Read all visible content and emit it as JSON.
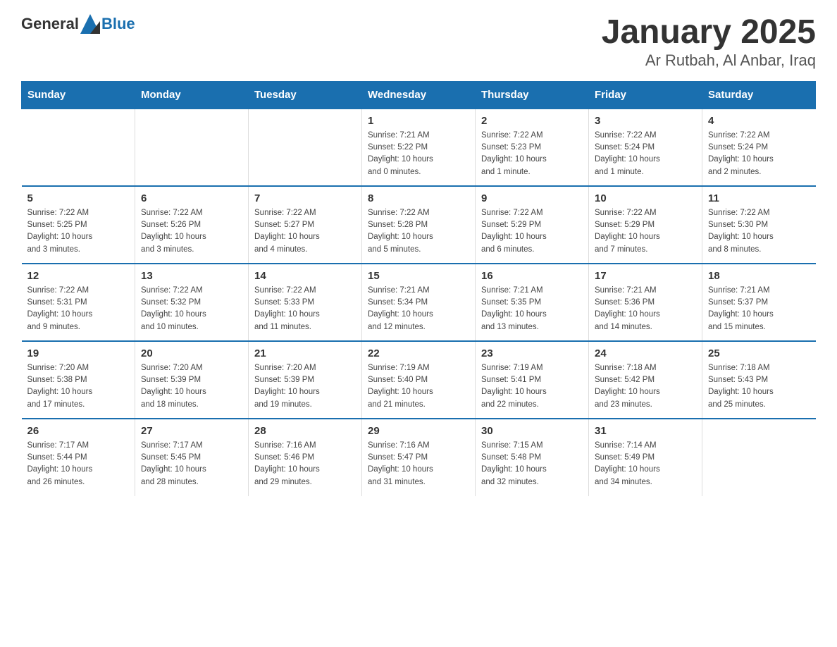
{
  "header": {
    "logo_general": "General",
    "logo_blue": "Blue",
    "title": "January 2025",
    "subtitle": "Ar Rutbah, Al Anbar, Iraq"
  },
  "calendar": {
    "days_of_week": [
      "Sunday",
      "Monday",
      "Tuesday",
      "Wednesday",
      "Thursday",
      "Friday",
      "Saturday"
    ],
    "weeks": [
      [
        {
          "day": "",
          "info": ""
        },
        {
          "day": "",
          "info": ""
        },
        {
          "day": "",
          "info": ""
        },
        {
          "day": "1",
          "info": "Sunrise: 7:21 AM\nSunset: 5:22 PM\nDaylight: 10 hours\nand 0 minutes."
        },
        {
          "day": "2",
          "info": "Sunrise: 7:22 AM\nSunset: 5:23 PM\nDaylight: 10 hours\nand 1 minute."
        },
        {
          "day": "3",
          "info": "Sunrise: 7:22 AM\nSunset: 5:24 PM\nDaylight: 10 hours\nand 1 minute."
        },
        {
          "day": "4",
          "info": "Sunrise: 7:22 AM\nSunset: 5:24 PM\nDaylight: 10 hours\nand 2 minutes."
        }
      ],
      [
        {
          "day": "5",
          "info": "Sunrise: 7:22 AM\nSunset: 5:25 PM\nDaylight: 10 hours\nand 3 minutes."
        },
        {
          "day": "6",
          "info": "Sunrise: 7:22 AM\nSunset: 5:26 PM\nDaylight: 10 hours\nand 3 minutes."
        },
        {
          "day": "7",
          "info": "Sunrise: 7:22 AM\nSunset: 5:27 PM\nDaylight: 10 hours\nand 4 minutes."
        },
        {
          "day": "8",
          "info": "Sunrise: 7:22 AM\nSunset: 5:28 PM\nDaylight: 10 hours\nand 5 minutes."
        },
        {
          "day": "9",
          "info": "Sunrise: 7:22 AM\nSunset: 5:29 PM\nDaylight: 10 hours\nand 6 minutes."
        },
        {
          "day": "10",
          "info": "Sunrise: 7:22 AM\nSunset: 5:29 PM\nDaylight: 10 hours\nand 7 minutes."
        },
        {
          "day": "11",
          "info": "Sunrise: 7:22 AM\nSunset: 5:30 PM\nDaylight: 10 hours\nand 8 minutes."
        }
      ],
      [
        {
          "day": "12",
          "info": "Sunrise: 7:22 AM\nSunset: 5:31 PM\nDaylight: 10 hours\nand 9 minutes."
        },
        {
          "day": "13",
          "info": "Sunrise: 7:22 AM\nSunset: 5:32 PM\nDaylight: 10 hours\nand 10 minutes."
        },
        {
          "day": "14",
          "info": "Sunrise: 7:22 AM\nSunset: 5:33 PM\nDaylight: 10 hours\nand 11 minutes."
        },
        {
          "day": "15",
          "info": "Sunrise: 7:21 AM\nSunset: 5:34 PM\nDaylight: 10 hours\nand 12 minutes."
        },
        {
          "day": "16",
          "info": "Sunrise: 7:21 AM\nSunset: 5:35 PM\nDaylight: 10 hours\nand 13 minutes."
        },
        {
          "day": "17",
          "info": "Sunrise: 7:21 AM\nSunset: 5:36 PM\nDaylight: 10 hours\nand 14 minutes."
        },
        {
          "day": "18",
          "info": "Sunrise: 7:21 AM\nSunset: 5:37 PM\nDaylight: 10 hours\nand 15 minutes."
        }
      ],
      [
        {
          "day": "19",
          "info": "Sunrise: 7:20 AM\nSunset: 5:38 PM\nDaylight: 10 hours\nand 17 minutes."
        },
        {
          "day": "20",
          "info": "Sunrise: 7:20 AM\nSunset: 5:39 PM\nDaylight: 10 hours\nand 18 minutes."
        },
        {
          "day": "21",
          "info": "Sunrise: 7:20 AM\nSunset: 5:39 PM\nDaylight: 10 hours\nand 19 minutes."
        },
        {
          "day": "22",
          "info": "Sunrise: 7:19 AM\nSunset: 5:40 PM\nDaylight: 10 hours\nand 21 minutes."
        },
        {
          "day": "23",
          "info": "Sunrise: 7:19 AM\nSunset: 5:41 PM\nDaylight: 10 hours\nand 22 minutes."
        },
        {
          "day": "24",
          "info": "Sunrise: 7:18 AM\nSunset: 5:42 PM\nDaylight: 10 hours\nand 23 minutes."
        },
        {
          "day": "25",
          "info": "Sunrise: 7:18 AM\nSunset: 5:43 PM\nDaylight: 10 hours\nand 25 minutes."
        }
      ],
      [
        {
          "day": "26",
          "info": "Sunrise: 7:17 AM\nSunset: 5:44 PM\nDaylight: 10 hours\nand 26 minutes."
        },
        {
          "day": "27",
          "info": "Sunrise: 7:17 AM\nSunset: 5:45 PM\nDaylight: 10 hours\nand 28 minutes."
        },
        {
          "day": "28",
          "info": "Sunrise: 7:16 AM\nSunset: 5:46 PM\nDaylight: 10 hours\nand 29 minutes."
        },
        {
          "day": "29",
          "info": "Sunrise: 7:16 AM\nSunset: 5:47 PM\nDaylight: 10 hours\nand 31 minutes."
        },
        {
          "day": "30",
          "info": "Sunrise: 7:15 AM\nSunset: 5:48 PM\nDaylight: 10 hours\nand 32 minutes."
        },
        {
          "day": "31",
          "info": "Sunrise: 7:14 AM\nSunset: 5:49 PM\nDaylight: 10 hours\nand 34 minutes."
        },
        {
          "day": "",
          "info": ""
        }
      ]
    ]
  }
}
